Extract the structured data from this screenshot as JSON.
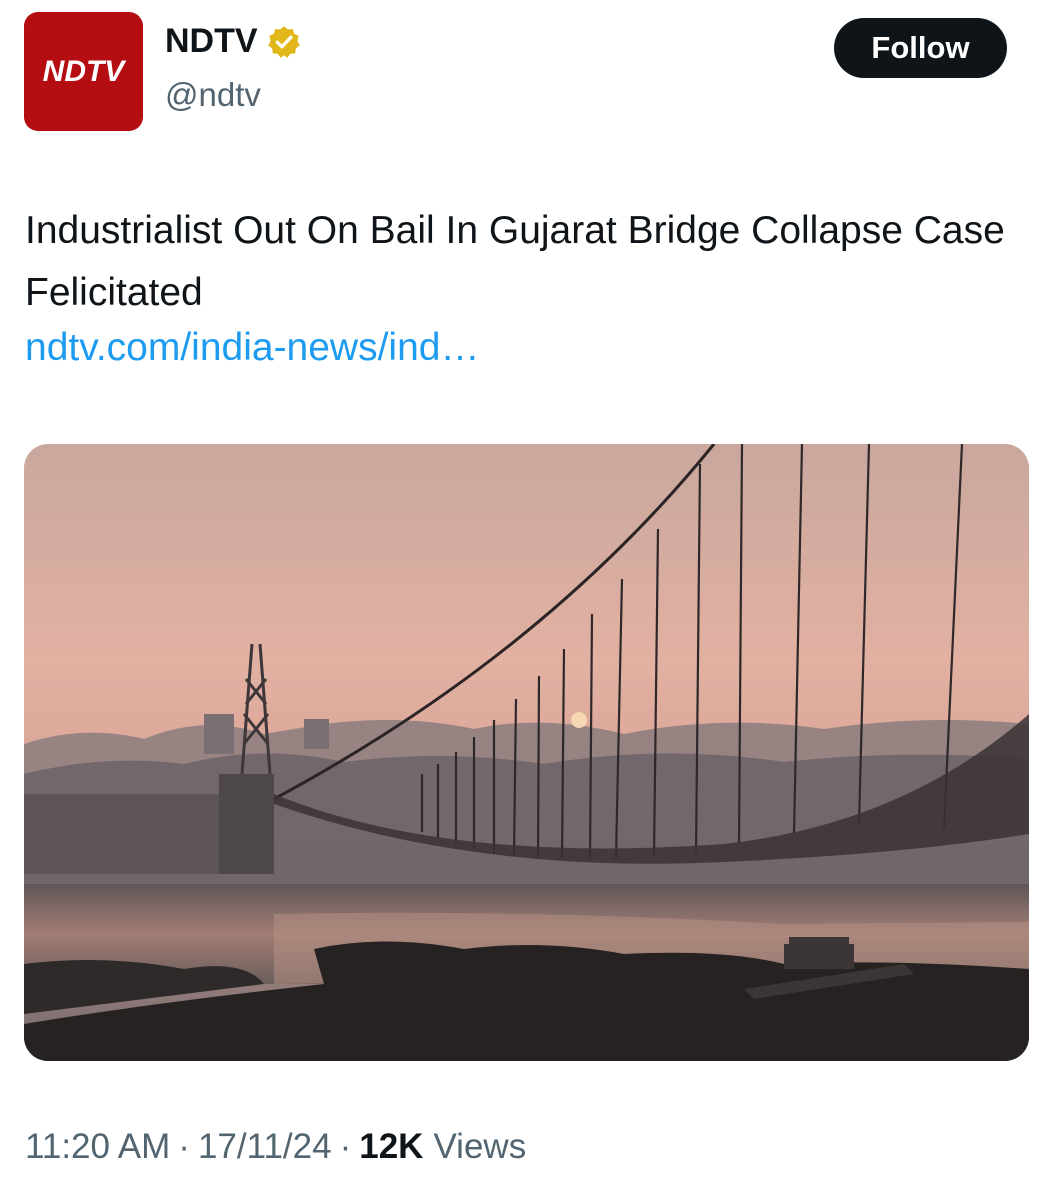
{
  "account": {
    "avatar_text": "NDTV",
    "avatar_color": "#b40e12",
    "display_name": "NDTV",
    "verified_badge": "gold-verified-badge-icon",
    "verified_color": "#e2b719",
    "handle": "@ndtv"
  },
  "follow_button": {
    "label": "Follow"
  },
  "tweet": {
    "text": "Industrialist Out On Bail In Gujarat Bridge Collapse Case Felicitated",
    "link": "ndtv.com/india-news/ind…",
    "link_color": "#1d9bf0",
    "media": {
      "description_icon": "suspension-bridge-sunset-photo"
    }
  },
  "meta": {
    "time": "11:20 AM",
    "separator": "·",
    "date": "17/11/24",
    "views_count": "12K",
    "views_label": "Views"
  }
}
